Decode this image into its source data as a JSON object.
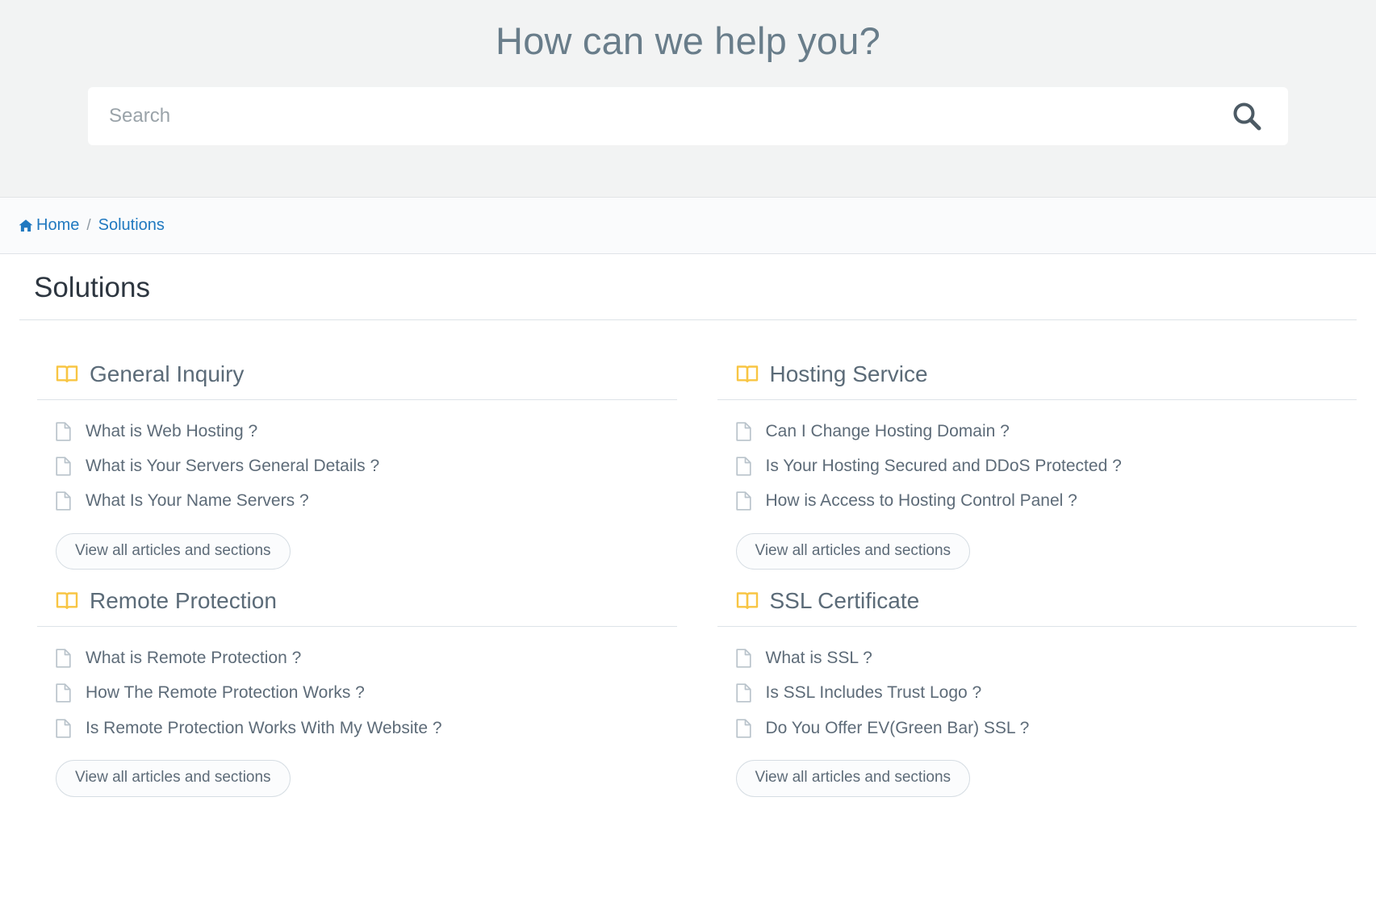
{
  "header": {
    "title": "How can we help you?",
    "search": {
      "value": "",
      "placeholder": "Search",
      "icon": "search-icon"
    }
  },
  "breadcrumb": {
    "home_icon": "home-icon",
    "home_label": "Home",
    "separator": "/",
    "current_label": "Solutions"
  },
  "page": {
    "title": "Solutions"
  },
  "colors": {
    "hero_background": "#F2F3F3",
    "breadcrumb_background": "#FAFBFC",
    "link_blue": "#2079C0",
    "book_icon_yellow": "#F8C543",
    "heading_slate": "#5B6B78",
    "title_dark": "#2D3640",
    "rule_gray": "#DDE3E8"
  },
  "categories": [
    {
      "icon": "open-book-icon",
      "name": "General Inquiry",
      "articles": [
        "What is Web Hosting ?",
        "What is Your Servers General Details ?",
        "What Is Your Name Servers ?"
      ],
      "view_all_label": "View all articles and sections"
    },
    {
      "icon": "open-book-icon",
      "name": "Hosting Service",
      "articles": [
        "Can I Change Hosting Domain ?",
        "Is Your Hosting Secured and DDoS Protected ?",
        "How is Access to Hosting Control Panel ?"
      ],
      "view_all_label": "View all articles and sections"
    },
    {
      "icon": "open-book-icon",
      "name": "Remote Protection",
      "articles": [
        "What is Remote Protection ?",
        "How The Remote Protection Works ?",
        "Is Remote Protection Works With My Website ?"
      ],
      "view_all_label": "View all articles and sections"
    },
    {
      "icon": "open-book-icon",
      "name": "SSL Certificate",
      "articles": [
        "What is SSL ?",
        "Is SSL Includes Trust Logo ?",
        "Do You Offer EV(Green Bar) SSL ?"
      ],
      "view_all_label": "View all articles and sections"
    }
  ]
}
